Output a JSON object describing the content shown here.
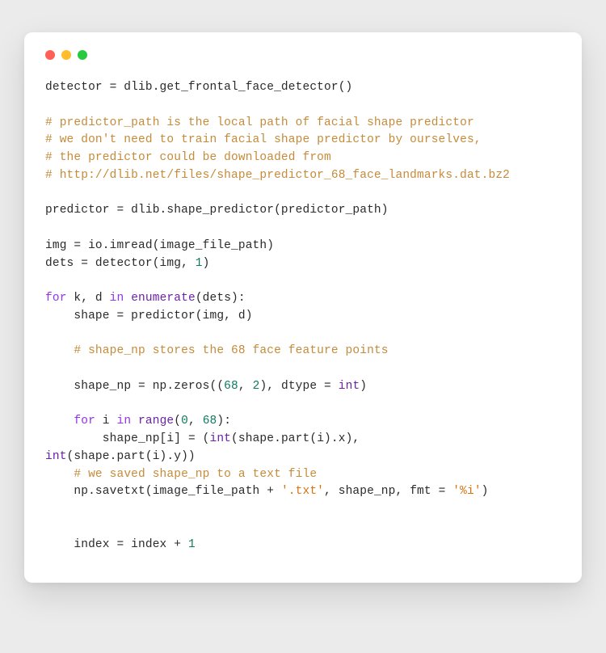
{
  "colors": {
    "bg": "#ebebeb",
    "window": "#ffffff",
    "traffic_red": "#ff5f56",
    "traffic_yellow": "#ffbd2e",
    "traffic_green": "#27c93f",
    "comment": "#c58b3a",
    "keyword": "#9333ea",
    "number": "#0e7a5f",
    "string": "#d9730d",
    "plain": "#2a2a2a"
  },
  "code_lines": {
    "l1": "detector = dlib.get_frontal_face_detector()",
    "l2": "",
    "l3": "# predictor_path is the local path of facial shape predictor",
    "l4": "# we don't need to train facial shape predictor by ourselves,",
    "l5": "# the predictor could be downloaded from",
    "l6": "# http://dlib.net/files/shape_predictor_68_face_landmarks.dat.bz2",
    "l7": "",
    "l8": "predictor = dlib.shape_predictor(predictor_path)",
    "l9": "",
    "l10": "img = io.imread(image_file_path)",
    "l11a": "dets = detector(img, ",
    "l11b": "1",
    "l11c": ")",
    "l12": "",
    "l13a": "for",
    "l13b": " k, d ",
    "l13c": "in",
    "l13d": " ",
    "l13e": "enumerate",
    "l13f": "(dets):",
    "l14": "    shape = predictor(img, d)",
    "l15": "",
    "l16": "    # shape_np stores the 68 face feature points",
    "l17": "",
    "l18a": "    shape_np = np.zeros((",
    "l18b": "68",
    "l18c": ", ",
    "l18d": "2",
    "l18e": "), dtype = ",
    "l18f": "int",
    "l18g": ")",
    "l19": "",
    "l20a": "    ",
    "l20b": "for",
    "l20c": " i ",
    "l20d": "in",
    "l20e": " ",
    "l20f": "range",
    "l20g": "(",
    "l20h": "0",
    "l20i": ", ",
    "l20j": "68",
    "l20k": "):",
    "l21a": "        shape_np[i] = (",
    "l21b": "int",
    "l21c": "(shape.part(i).x),                            ",
    "l21d": "int",
    "l21e": "(shape.part(i).y))",
    "l22": "    # we saved shape_np to a text file",
    "l23a": "    np.savetxt(image_file_path + ",
    "l23b": "'.txt'",
    "l23c": ", shape_np, fmt = ",
    "l23d": "'%i'",
    "l23e": ")",
    "l24": "",
    "l25": "",
    "l26a": "    index = index + ",
    "l26b": "1"
  }
}
